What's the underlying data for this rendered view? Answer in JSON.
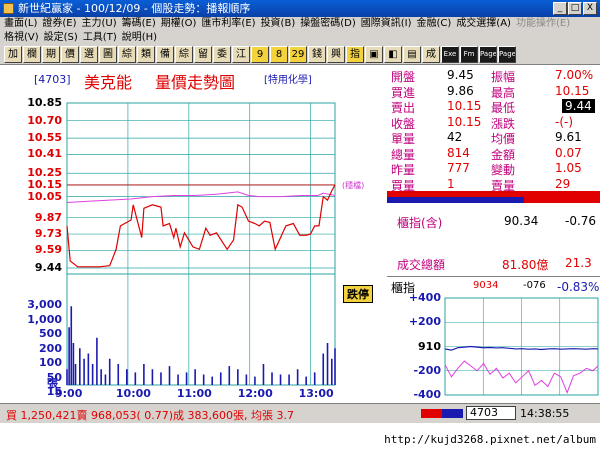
{
  "window": {
    "title": "新世紀贏家 - 100/12/09 - 個股走勢：播報順序",
    "min": "_",
    "max": "□",
    "close": "X"
  },
  "menu": {
    "row1": [
      "畫面(L)",
      "證券(E)",
      "主力(U)",
      "籌碼(E)",
      "期權(O)",
      "匯市利率(E)",
      "投資(B)",
      "操盤密碼(D)",
      "國際資訊(I)",
      "金融(C)",
      "成交選擇(A)",
      "功能操作(E)"
    ],
    "row1_disabled": [
      false,
      false,
      false,
      false,
      false,
      false,
      false,
      false,
      false,
      false,
      false,
      true
    ],
    "row2": [
      "格視(V)",
      "設定(S)",
      "工具(T)",
      "說明(H)"
    ]
  },
  "toolbar": [
    "加",
    "欄",
    "期",
    "價",
    "選",
    "圖",
    "綜",
    "類",
    "備",
    "綜",
    "留",
    "委",
    "江",
    "9",
    "8",
    "29",
    "錢",
    "興",
    "指",
    "▣",
    "◧",
    "▤",
    "成",
    "Exe",
    "Fm",
    "Page",
    "Page"
  ],
  "stock": {
    "code": "[4703]",
    "name": "美克能",
    "chart_title": "量價走勢圖",
    "sector": "[特用化學]",
    "vol_unit": "張",
    "ref_mark": "(穩檔)",
    "limit_badge": "跌停"
  },
  "quote": [
    {
      "l1": "開盤",
      "v1": "9.45",
      "l2": "振幅",
      "v2": "7.00%",
      "c1": "#000000",
      "c2": "#e00000"
    },
    {
      "l1": "買進",
      "v1": "9.86",
      "l2": "最高",
      "v2": "10.15",
      "c1": "#000000",
      "c2": "#e00000"
    },
    {
      "l1": "賣出",
      "v1": "10.15",
      "l2": "最低",
      "v2": "9.44",
      "c1": "#e00000",
      "c2": "#ffffff"
    },
    {
      "l1": "收盤",
      "v1": "10.15",
      "l2": "漲跌",
      "v2": "-(-)",
      "c1": "#e00000",
      "c2": "#e00000"
    },
    {
      "l1": "單量",
      "v1": "42",
      "l2": "均價",
      "v2": "9.61",
      "c1": "#000000",
      "c2": "#000000"
    },
    {
      "l1": "總量",
      "v1": "814",
      "l2": "金額",
      "v2": "0.07",
      "c1": "#e00000",
      "c2": "#e00000"
    },
    {
      "l1": "昨量",
      "v1": "777",
      "l2": "變動",
      "v2": "1.05",
      "c1": "#e00000",
      "c2": "#e00000"
    },
    {
      "l1": "買量",
      "v1": "1",
      "l2": "賣量",
      "v2": "29",
      "c1": "#e00000",
      "c2": "#e00000"
    }
  ],
  "index": {
    "label": "櫃指(含)",
    "value": "90.34",
    "change": "-0.76"
  },
  "turnover": {
    "label": "成交總額",
    "value": "81.80億",
    "extra": "21.3"
  },
  "otc": {
    "label": "櫃指",
    "value": "9034",
    "change": "-076",
    "pct": "-0.83%",
    "ticks": [
      "+400",
      "+200",
      "910",
      "-200",
      "-400"
    ]
  },
  "status": {
    "text": "買 1,250,421賣 968,053( 0.77)成 383,600張, 均張 3.7",
    "code": "4703",
    "time": "14:38:55"
  },
  "watermark": "http://kujd3268.pixnet.net/album",
  "colors": {
    "bg": "#ffffff",
    "price": "#e00000",
    "avg": "#e040e0",
    "volume": "#1a1ab0",
    "grid": "#2aa6a6",
    "ref": "#b03030"
  },
  "chart_data": {
    "type": "line",
    "x_ticks": [
      "9:00",
      "10:00",
      "11:00",
      "12:00",
      "13:00"
    ],
    "y_ticks": [
      "10.85",
      "10.70",
      "10.55",
      "10.41",
      "10.25",
      "10.15",
      "10.05",
      "9.87",
      "9.73",
      "9.59",
      "9.44"
    ],
    "y_tick_colors": [
      "#000000",
      "#e00000",
      "#e00000",
      "#e00000",
      "#e00000",
      "#e00000",
      "#e00000",
      "#e00000",
      "#e00000",
      "#e00000",
      "#000000"
    ],
    "ylim": [
      9.44,
      10.85
    ],
    "reference": 10.15,
    "price": {
      "name": "price",
      "x": [
        0,
        3,
        10,
        30,
        40,
        46,
        50,
        60,
        62,
        70,
        72,
        80,
        88,
        90,
        96,
        100,
        102,
        106,
        110,
        118,
        124,
        130,
        134,
        140,
        150,
        156,
        160,
        164,
        170,
        176,
        180,
        185,
        190,
        195,
        200,
        205,
        212,
        218,
        224,
        228,
        232,
        236,
        240,
        244,
        248,
        251
      ],
      "y": [
        9.8,
        9.5,
        9.45,
        9.45,
        9.46,
        9.6,
        9.8,
        9.85,
        9.98,
        9.7,
        9.95,
        9.98,
        9.96,
        9.8,
        9.82,
        9.7,
        9.78,
        9.62,
        9.74,
        9.62,
        9.6,
        9.78,
        9.72,
        9.74,
        9.6,
        9.68,
        9.98,
        9.96,
        9.84,
        9.82,
        9.8,
        9.84,
        9.83,
        9.6,
        9.7,
        9.8,
        9.82,
        9.72,
        9.72,
        9.73,
        9.8,
        9.8,
        10.05,
        10.02,
        10.1,
        10.15
      ]
    },
    "avg": {
      "name": "avg",
      "x": [
        0,
        20,
        40,
        60,
        80,
        100,
        120,
        140,
        160,
        170,
        180,
        200,
        220,
        235,
        240,
        251
      ],
      "y": [
        10.0,
        10.01,
        10.02,
        10.03,
        10.05,
        10.06,
        10.06,
        10.07,
        10.09,
        10.06,
        10.05,
        10.05,
        10.06,
        10.06,
        10.08,
        10.06
      ]
    },
    "volume": {
      "name": "volume",
      "ylim": [
        0,
        3000
      ],
      "y_ticks": [
        "3,000",
        "1,000",
        "500",
        "200",
        "100",
        "50",
        "15"
      ],
      "x": [
        0,
        2,
        4,
        6,
        8,
        12,
        16,
        20,
        24,
        28,
        32,
        36,
        40,
        48,
        56,
        64,
        72,
        80,
        88,
        96,
        104,
        112,
        120,
        128,
        136,
        144,
        152,
        160,
        168,
        176,
        184,
        192,
        200,
        208,
        216,
        224,
        232,
        240,
        244,
        248,
        251
      ],
      "v": [
        0.15,
        0.55,
        0.75,
        0.4,
        0.2,
        0.35,
        0.25,
        0.3,
        0.2,
        0.45,
        0.15,
        0.1,
        0.25,
        0.2,
        0.15,
        0.12,
        0.2,
        0.15,
        0.12,
        0.18,
        0.1,
        0.12,
        0.15,
        0.1,
        0.08,
        0.12,
        0.18,
        0.15,
        0.1,
        0.08,
        0.2,
        0.12,
        0.1,
        0.1,
        0.15,
        0.08,
        0.12,
        0.3,
        0.4,
        0.25,
        0.35
      ]
    },
    "otc_line": {
      "x": [
        0,
        10,
        20,
        30,
        40,
        50,
        60,
        70,
        80,
        90,
        100,
        110,
        120,
        130,
        140,
        150,
        160,
        170,
        180,
        190,
        200,
        210,
        220,
        230,
        238
      ],
      "y": [
        -20,
        -30,
        -10,
        -5,
        0,
        -5,
        -10,
        -8,
        -12,
        -10,
        -15,
        -20,
        -18,
        -22,
        -20,
        -25,
        -20,
        -18,
        -22,
        -20,
        -18,
        -20,
        -22,
        -18,
        -20
      ]
    },
    "otc_pink": {
      "x": [
        0,
        10,
        20,
        30,
        40,
        50,
        60,
        70,
        80,
        90,
        100,
        110,
        120,
        130,
        140,
        150,
        160,
        170,
        180,
        190,
        200,
        210,
        220,
        230,
        238
      ],
      "y": [
        -150,
        -250,
        -180,
        -120,
        -160,
        -200,
        -140,
        -230,
        -180,
        -260,
        -220,
        -300,
        -250,
        -200,
        -320,
        -280,
        -330,
        -220,
        -250,
        -380,
        -240,
        -220,
        -180,
        -200,
        -160
      ]
    }
  }
}
